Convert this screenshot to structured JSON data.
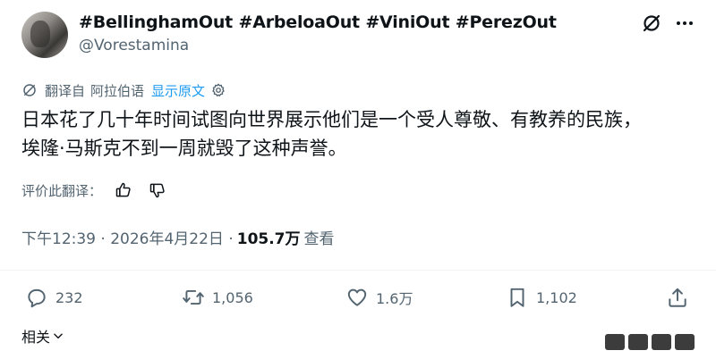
{
  "tweet": {
    "display_name": "#BellinghamOut #ArbeloaOut #ViniOut #PerezOut",
    "handle": "@Vorestamina",
    "text_line1": "日本花了几十年时间试图向世界展示他们是一个受人尊敬、有教养的民族，",
    "text_line2": "埃隆·马斯克不到一周就毁了这种声誉。",
    "timestamp": "下午12:39 · 2026年4月22日 · ",
    "views_count": "105.7万",
    "views_label": "查看"
  },
  "translation": {
    "translated_from": "翻译自",
    "language": "阿拉伯语",
    "show_original": "显示原文",
    "rate_label": "评价此翻译："
  },
  "actions": {
    "reply_count": "232",
    "retweet_count": "1,056",
    "like_count": "1.6万",
    "bookmark_count": "1,102"
  },
  "related": {
    "label": "相关"
  },
  "icons": {
    "grok": "grok-icon",
    "more": "more-icon",
    "translate": "translate-icon",
    "settings": "gear-icon",
    "thumbs_up": "thumbs-up-icon",
    "thumbs_down": "thumbs-down-icon",
    "reply": "reply-icon",
    "retweet": "retweet-icon",
    "like": "heart-icon",
    "bookmark": "bookmark-icon",
    "share": "share-icon",
    "chevron": "chevron-down-icon"
  },
  "colors": {
    "text": "#0f1419",
    "secondary": "#536471",
    "accent": "#1d9bf0"
  }
}
